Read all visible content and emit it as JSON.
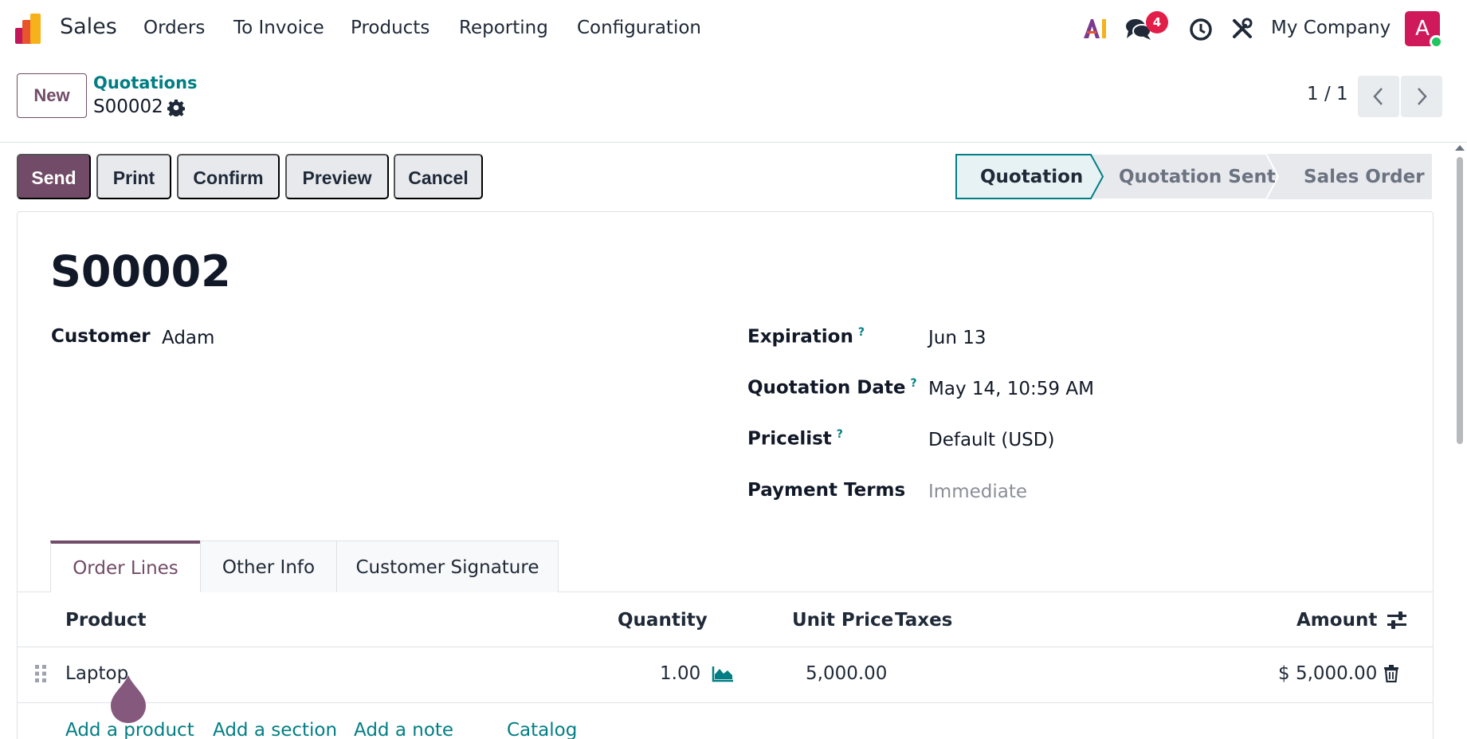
{
  "navbar": {
    "app_name": "Sales",
    "menu": [
      "Orders",
      "To Invoice",
      "Products",
      "Reporting",
      "Configuration"
    ],
    "messages_count": "4",
    "company": "My Company",
    "avatar_letter": "A"
  },
  "control_panel": {
    "new_label": "New",
    "breadcrumb_parent": "Quotations",
    "breadcrumb_current": "S00002",
    "pager_value": "1 / 1"
  },
  "actions": {
    "send": "Send",
    "print": "Print",
    "confirm": "Confirm",
    "preview": "Preview",
    "cancel": "Cancel"
  },
  "statusbar": {
    "stages": [
      "Quotation",
      "Quotation Sent",
      "Sales Order"
    ],
    "current": "Quotation"
  },
  "form": {
    "title": "S00002",
    "customer_label": "Customer",
    "customer_value": "Adam",
    "expiration_label": "Expiration",
    "expiration_value": "Jun 13",
    "quotation_date_label": "Quotation Date",
    "quotation_date_value": "May 14, 10:59 AM",
    "pricelist_label": "Pricelist",
    "pricelist_value": "Default (USD)",
    "payment_terms_label": "Payment Terms",
    "payment_terms_placeholder": "Immediate",
    "help_mark": "?"
  },
  "tabs": [
    "Order Lines",
    "Other Info",
    "Customer Signature"
  ],
  "order_lines": {
    "columns": {
      "product": "Product",
      "quantity": "Quantity",
      "unit_price": "Unit Price",
      "taxes": "Taxes",
      "amount": "Amount"
    },
    "rows": [
      {
        "product": "Laptop",
        "quantity": "1.00",
        "unit_price": "5,000.00",
        "taxes": "",
        "amount": "$ 5,000.00"
      }
    ],
    "add_product": "Add a product",
    "add_section": "Add a section",
    "add_note": "Add a note",
    "catalog": "Catalog"
  },
  "colors": {
    "brand": "#714b67",
    "link": "#017e84",
    "badge": "#e11d48"
  }
}
